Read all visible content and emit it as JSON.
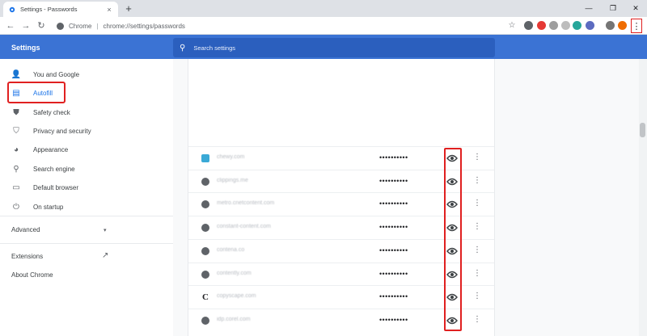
{
  "tab": {
    "title": "Settings - Passwords",
    "close": "×",
    "new_tab": "+"
  },
  "window": {
    "minimize": "—",
    "maximize": "❐",
    "close": "✕"
  },
  "toolbar": {
    "back": "←",
    "forward": "→",
    "reload": "↻",
    "scheme": "Chrome",
    "separator": "|",
    "url": "chrome://settings/passwords",
    "bookmark": "☆",
    "menu": "⋮"
  },
  "extensions": [
    {
      "color": "#5f6368"
    },
    {
      "color": "#e53935"
    },
    {
      "color": "#9e9e9e"
    },
    {
      "color": "#bdbdbd"
    },
    {
      "color": "#26a69a"
    },
    {
      "color": "#5c6bc0"
    },
    {
      "color": "#757575"
    },
    {
      "color": "#ef6c00"
    }
  ],
  "settings": {
    "title": "Settings",
    "search_placeholder": "Search settings"
  },
  "sidebar": {
    "items": [
      {
        "label": "You and Google",
        "icon": "person-icon",
        "glyph": "👤"
      },
      {
        "label": "Autofill",
        "icon": "clipboard-icon",
        "glyph": "▤",
        "active": true
      },
      {
        "label": "Safety check",
        "icon": "shield-icon",
        "glyph": "⛊"
      },
      {
        "label": "Privacy and security",
        "icon": "shield-lock-icon",
        "glyph": "⛉"
      },
      {
        "label": "Appearance",
        "icon": "palette-icon",
        "glyph": "◕"
      },
      {
        "label": "Search engine",
        "icon": "search-icon",
        "glyph": "⚲"
      },
      {
        "label": "Default browser",
        "icon": "browser-icon",
        "glyph": "▭"
      },
      {
        "label": "On startup",
        "icon": "power-icon",
        "glyph": "⏻"
      }
    ],
    "advanced": "Advanced",
    "advanced_chevron": "▾",
    "extensions": "Extensions",
    "extensions_icon": "↗",
    "about": "About Chrome"
  },
  "passwords": [
    {
      "site": "chewy.com",
      "icon": "chewy",
      "password": "••••••••••"
    },
    {
      "site": "clippings.me",
      "icon": "globe",
      "password": "••••••••••"
    },
    {
      "site": "metro.cnetcontent.com",
      "icon": "globe",
      "password": "••••••••••"
    },
    {
      "site": "constant-content.com",
      "icon": "globe",
      "password": "••••••••••"
    },
    {
      "site": "contena.co",
      "icon": "globe",
      "password": "••••••••••"
    },
    {
      "site": "contently.com",
      "icon": "globe",
      "password": "••••••••••"
    },
    {
      "site": "copyscape.com",
      "icon": "letter",
      "letter": "C",
      "password": "••••••••••"
    },
    {
      "site": "idp.corel.com",
      "icon": "globe",
      "password": "••••••••••"
    }
  ],
  "row_more": "⋮"
}
